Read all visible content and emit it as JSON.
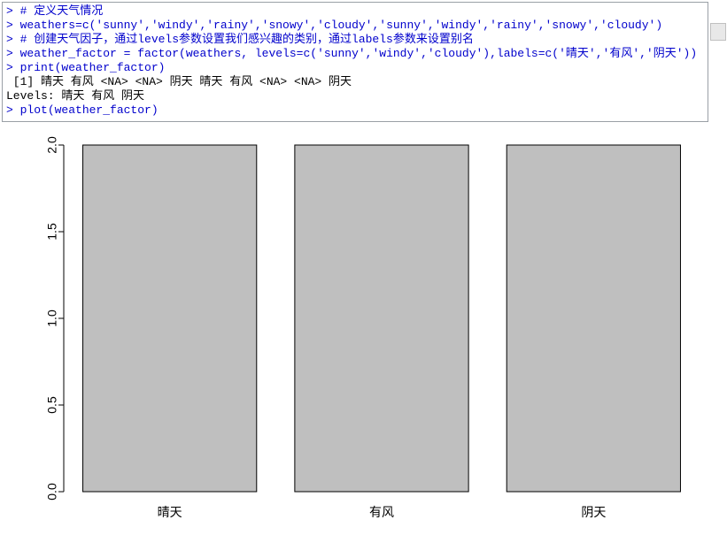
{
  "console": {
    "lines": [
      {
        "kind": "input",
        "prompt": "> ",
        "text": "# 定义天气情况"
      },
      {
        "kind": "input",
        "prompt": "> ",
        "text": "weathers=c('sunny','windy','rainy','snowy','cloudy','sunny','windy','rainy','snowy','cloudy')"
      },
      {
        "kind": "input",
        "prompt": "> ",
        "text": "# 创建天气因子，通过levels参数设置我们感兴趣的类别，通过labels参数来设置别名"
      },
      {
        "kind": "input",
        "prompt": "> ",
        "text": "weather_factor = factor(weathers, levels=c('sunny','windy','cloudy'),labels=c('晴天','有风','阴天'))"
      },
      {
        "kind": "input",
        "prompt": "> ",
        "text": "print(weather_factor)"
      },
      {
        "kind": "output",
        "prompt": "",
        "text": " [1] 晴天 有风 <NA> <NA> 阴天 晴天 有风 <NA> <NA> 阴天"
      },
      {
        "kind": "output",
        "prompt": "",
        "text": "Levels: 晴天 有风 阴天"
      },
      {
        "kind": "input",
        "prompt": "> ",
        "text": "plot(weather_factor)"
      }
    ]
  },
  "chart_data": {
    "type": "bar",
    "categories": [
      "晴天",
      "有风",
      "阴天"
    ],
    "values": [
      2,
      2,
      2
    ],
    "y_ticks": [
      0.0,
      0.5,
      1.0,
      1.5,
      2.0
    ],
    "ylim": [
      0,
      2
    ],
    "xlabel": "",
    "ylabel": "",
    "title": ""
  }
}
